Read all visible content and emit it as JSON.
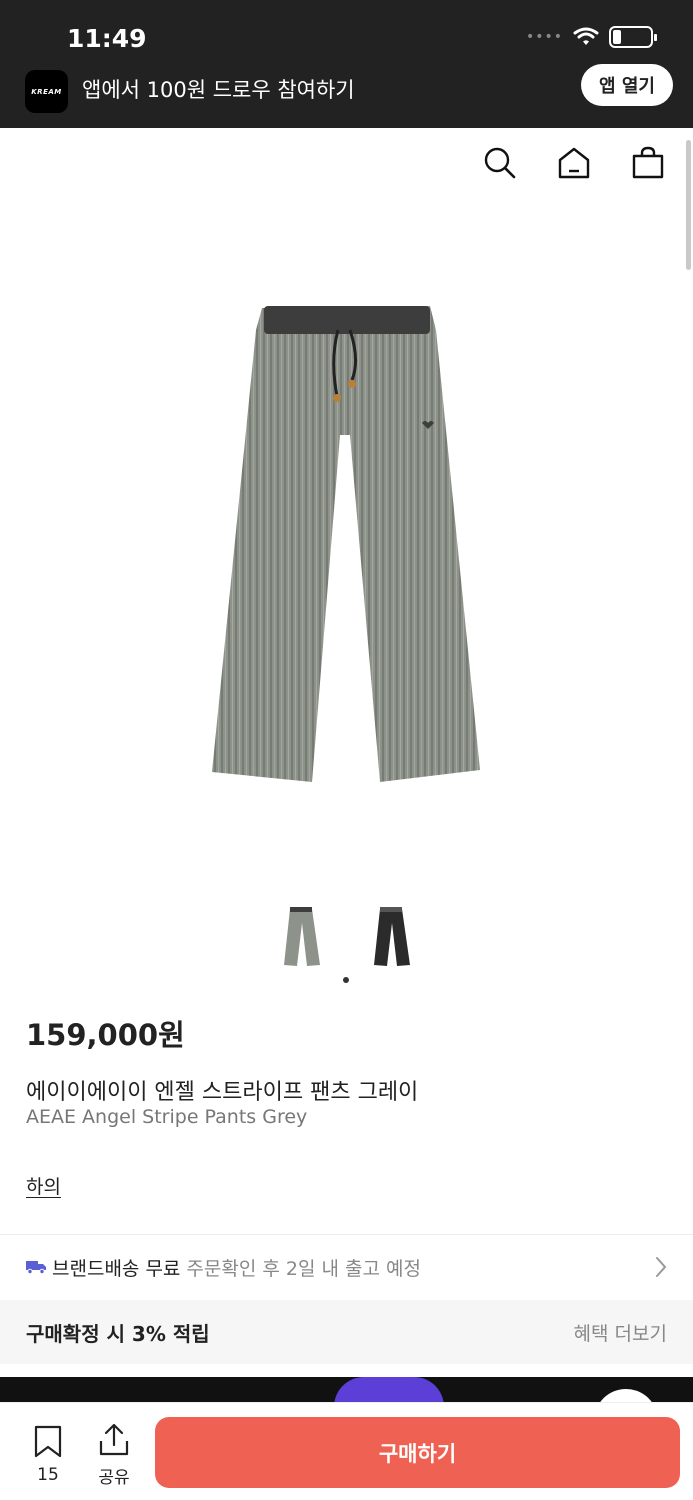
{
  "status_bar": {
    "time": "11:49",
    "signal": "••••"
  },
  "app_banner": {
    "logo_text": "KREAM",
    "text": "앱에서 100원 드로우 참여하기",
    "open_button": "앱 열기"
  },
  "header": {
    "icons": [
      "search-icon",
      "home-icon",
      "shopping-bag-icon"
    ]
  },
  "product": {
    "price": "159,000원",
    "name_ko": "에이이에이이 엔젤 스트라이프 팬츠 그레이",
    "name_en": "AEAE Angel Stripe Pants Grey",
    "category": "하의",
    "thumbnails": [
      "grey",
      "black"
    ],
    "selected_thumbnail": 1
  },
  "shipping": {
    "strong": "브랜드배송 무료",
    "sub": "주문확인 후 2일 내 출고 예정"
  },
  "benefit": {
    "left": "구매확정 시 3% 적립",
    "right": "혜택 더보기"
  },
  "bottom_bar": {
    "bookmark_count": "15",
    "share_label": "공유",
    "buy_label": "구매하기"
  },
  "colors": {
    "buy_button": "#ef6253",
    "top_bar": "#222222",
    "product_grey": "#8a8f87"
  }
}
